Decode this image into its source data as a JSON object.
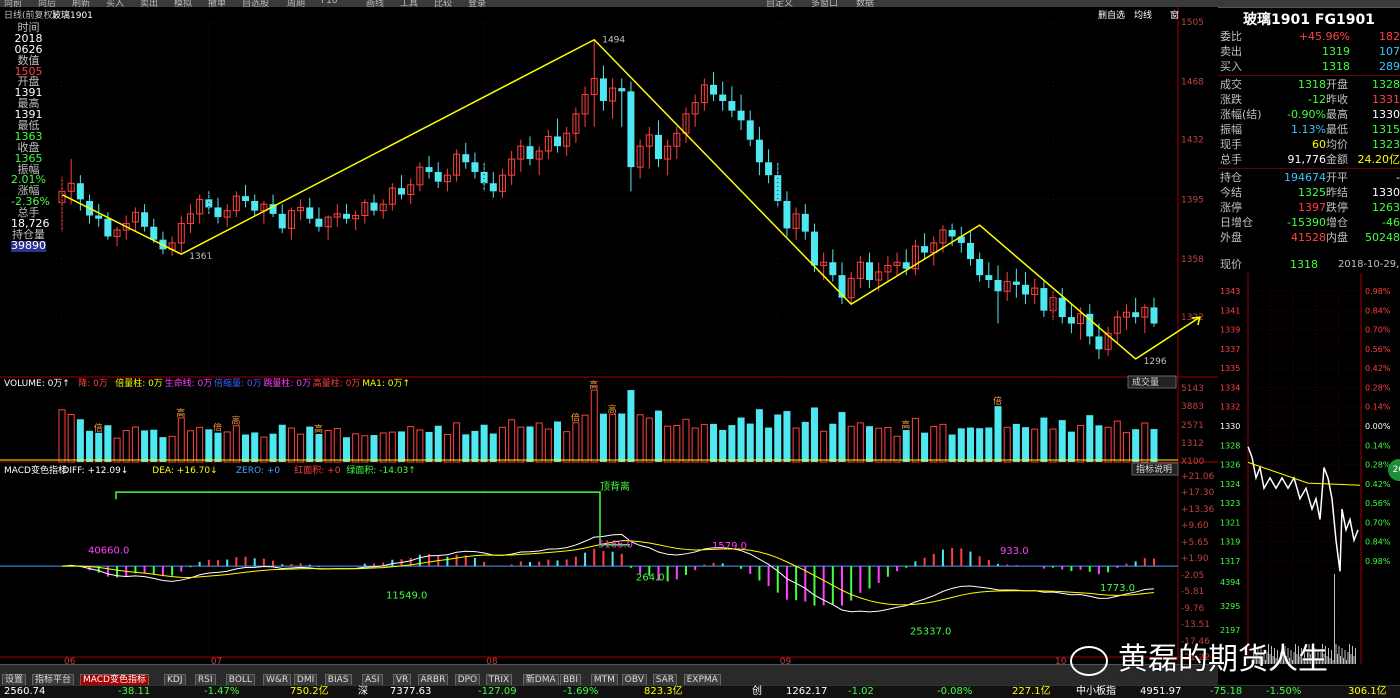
{
  "toolbar": {
    "buttons": [
      "向前",
      "向后",
      "刷新",
      "买入",
      "卖出",
      "模拟",
      "撤单",
      "自选股",
      "周期",
      "F10",
      "画线",
      "工具",
      "比较",
      "登录",
      "",
      "",
      "",
      "",
      "",
      "",
      "",
      "",
      "",
      "",
      "",
      "",
      "自定义",
      "多窗口",
      "数据"
    ]
  },
  "chart_header": {
    "title": "日线(前复权)",
    "symbol": "玻璃1901",
    "right_controls": [
      "删自选",
      "均线",
      "窗"
    ]
  },
  "sidebox": {
    "items": [
      {
        "label": "时间",
        "value": "2018"
      },
      {
        "label": "",
        "value": "0626"
      },
      {
        "label": "数值",
        "value": "1505"
      },
      {
        "label": "开盘",
        "value": "1391"
      },
      {
        "label": "最高",
        "value": "1391"
      },
      {
        "label": "最低",
        "value": "1363"
      },
      {
        "label": "收盘",
        "value": "1365"
      },
      {
        "label": "振幅",
        "value": "2.01%"
      },
      {
        "label": "涨幅",
        "value": "-2.36%"
      },
      {
        "label": "总手",
        "value": "18,726"
      },
      {
        "label": "持仓量",
        "value": "39890"
      }
    ]
  },
  "volume_header": {
    "items": [
      {
        "text": "VOLUME: 0万↑",
        "color": "#ffffff"
      },
      {
        "text": "降: 0万",
        "color": "#ff4040"
      },
      {
        "text": "倍量柱: 0万",
        "color": "#ffff00"
      },
      {
        "text": "生命线: 0万",
        "color": "#ff40ff"
      },
      {
        "text": "倍缩量: 0万",
        "color": "#4060ff"
      },
      {
        "text": "跳量柱: 0万",
        "color": "#ff40ff"
      },
      {
        "text": "高量柱: 0万",
        "color": "#ff4040"
      },
      {
        "text": "MA1: 0万↑",
        "color": "#ffff00"
      }
    ],
    "button": "成交量"
  },
  "macd_header": {
    "items": [
      {
        "text": "MACD变色指标",
        "color": "#ffffff"
      },
      {
        "text": "DIFF: +12.09↓",
        "color": "#ffffff"
      },
      {
        "text": "DEA: +16.70↓",
        "color": "#ffff00"
      },
      {
        "text": "ZERO: +0",
        "color": "#40a0ff"
      },
      {
        "text": "红面积: +0",
        "color": "#ff4040"
      },
      {
        "text": "绿面积: -14.03↑",
        "color": "#40ff40"
      }
    ],
    "button": "指标说明"
  },
  "macd_labels": [
    "40660.0",
    "11549.0",
    "5166.0",
    "264.0",
    "1579.0",
    "25337.0",
    "933.0",
    "1773.0"
  ],
  "macd_annotation": "顶背离",
  "volume_annotations": [
    "倍",
    "高",
    "倍",
    "高",
    "高",
    "倍",
    "高",
    "高",
    "高",
    "倍"
  ],
  "quote": {
    "title": "玻璃1901 FG1901",
    "rows1": [
      {
        "l": "委比",
        "v": "+45.96%",
        "vc": "#ff4040",
        "r": "182",
        "rc": "#ff4040"
      },
      {
        "l": "卖出",
        "v": "1319",
        "vc": "#40ff40",
        "r": "107",
        "rc": "#40c0ff"
      },
      {
        "l": "买入",
        "v": "1318",
        "vc": "#40ff40",
        "r": "289",
        "rc": "#40c0ff"
      }
    ],
    "rows2": [
      {
        "l": "成交",
        "v": "1318",
        "vc": "#40ff40",
        "l2": "开盘",
        "r": "1328",
        "rc": "#40ff40"
      },
      {
        "l": "涨跌",
        "v": "-12",
        "vc": "#40ff40",
        "l2": "昨收",
        "r": "1331",
        "rc": "#ff4040"
      },
      {
        "l": "涨幅(结)",
        "v": "-0.90%",
        "vc": "#40ff40",
        "l2": "最高",
        "r": "1330",
        "rc": "#ffffff"
      },
      {
        "l": "振幅",
        "v": "1.13%",
        "vc": "#40c0ff",
        "l2": "最低",
        "r": "1315",
        "rc": "#40ff40"
      },
      {
        "l": "现手",
        "v": "60",
        "vc": "#ffff00",
        "l2": "均价",
        "r": "1323",
        "rc": "#40ff40"
      },
      {
        "l": "总手",
        "v": "91,776",
        "vc": "#ffffff",
        "l2": "金额",
        "r": "24.20亿",
        "rc": "#ffff00"
      }
    ],
    "rows3": [
      {
        "l": "持仓",
        "v": "194674",
        "vc": "#40c0ff",
        "l2": "开平",
        "r": "-",
        "rc": "#ffffff"
      },
      {
        "l": "今结",
        "v": "1325",
        "vc": "#40ff40",
        "l2": "昨结",
        "r": "1330",
        "rc": "#ffffff"
      },
      {
        "l": "涨停",
        "v": "1397",
        "vc": "#ff4040",
        "l2": "跌停",
        "r": "1263",
        "rc": "#40ff40"
      },
      {
        "l": "日增仓",
        "v": "-15390",
        "vc": "#40ff40",
        "l2": "增仓",
        "r": "-46",
        "rc": "#40ff40"
      },
      {
        "l": "外盘",
        "v": "41528",
        "vc": "#ff4040",
        "l2": "内盘",
        "r": "50248",
        "rc": "#40ff40"
      }
    ]
  },
  "mini_chart": {
    "header_label": "现价",
    "header_price": "1318",
    "header_date": "2018-10-29,一",
    "price_ticks": [
      "1343",
      "1341",
      "1339",
      "1337",
      "1335",
      "1334",
      "1332",
      "1330",
      "1328",
      "1326",
      "1324",
      "1323",
      "1321",
      "1319",
      "1317"
    ],
    "pct_ticks": [
      "0.98%",
      "0.84%",
      "0.70%",
      "0.56%",
      "0.42%",
      "0.28%",
      "0.14%",
      "0.00%",
      "0.14%",
      "0.28%",
      "0.42%",
      "0.56%",
      "0.70%",
      "0.84%",
      "0.98%"
    ],
    "vol_ticks": [
      "4394",
      "3295",
      "2197"
    ],
    "badge": "2G"
  },
  "bottom_tabs": [
    "设置",
    "指标平台",
    "MACD变色指标",
    "KDJ",
    "RSI",
    "BOLL",
    "W&R",
    "DMI",
    "BIAS",
    "ASI",
    "VR",
    "ARBR",
    "DPO",
    "TRIX",
    "新DMA",
    "BBI",
    "MTM",
    "OBV",
    "SAR",
    "EXPMA"
  ],
  "ticker": [
    {
      "t": "2560.74",
      "c": "#ffffff"
    },
    {
      "t": "-38.11",
      "c": "#40ff40"
    },
    {
      "t": "-1.47%",
      "c": "#40ff40"
    },
    {
      "t": "750.2亿",
      "c": "#ffff00"
    },
    {
      "t": "深",
      "c": "#ffffff"
    },
    {
      "t": "7377.63",
      "c": "#ffffff"
    },
    {
      "t": "-127.09",
      "c": "#40ff40"
    },
    {
      "t": "-1.69%",
      "c": "#40ff40"
    },
    {
      "t": "823.3亿",
      "c": "#ffff00"
    },
    {
      "t": "创",
      "c": "#ffffff"
    },
    {
      "t": "1262.17",
      "c": "#ffffff"
    },
    {
      "t": "-1.02",
      "c": "#40ff40"
    },
    {
      "t": "-0.08%",
      "c": "#40ff40"
    },
    {
      "t": "227.1亿",
      "c": "#ffff00"
    },
    {
      "t": "中小板指",
      "c": "#ffffff"
    },
    {
      "t": "4951.97",
      "c": "#ffffff"
    },
    {
      "t": "-75.18",
      "c": "#40ff40"
    },
    {
      "t": "-1.50%",
      "c": "#40ff40"
    },
    {
      "t": "306.1亿",
      "c": "#ffff00"
    }
  ],
  "watermark": "黄磊的期货人生",
  "chart_data": [
    {
      "type": "candlestick",
      "yticks": [
        1505,
        1468,
        1432,
        1395,
        1358,
        1322
      ],
      "ylim": [
        1296,
        1505
      ],
      "x_date_labels": [
        "06",
        "07",
        "08",
        "09",
        "10"
      ],
      "x_date_index": [
        0,
        16,
        46,
        78,
        108
      ],
      "zigzag": [
        {
          "i": 0,
          "price": 1398,
          "label": ""
        },
        {
          "i": 13,
          "price": 1361,
          "label": "1361"
        },
        {
          "i": 58,
          "price": 1494,
          "label": "1494"
        },
        {
          "i": 86,
          "price": 1330,
          "label": ""
        },
        {
          "i": 100,
          "price": 1379,
          "label": ""
        },
        {
          "i": 117,
          "price": 1296,
          "label": "1296"
        },
        {
          "i": 124,
          "price": 1322,
          "label": ""
        }
      ],
      "ohlc": [
        [
          1393,
          1409,
          1375,
          1400
        ],
        [
          1400,
          1420,
          1392,
          1405
        ],
        [
          1405,
          1410,
          1388,
          1395
        ],
        [
          1394,
          1398,
          1380,
          1385
        ],
        [
          1385,
          1392,
          1378,
          1383
        ],
        [
          1383,
          1387,
          1370,
          1372
        ],
        [
          1372,
          1378,
          1366,
          1376
        ],
        [
          1376,
          1385,
          1370,
          1380
        ],
        [
          1381,
          1390,
          1375,
          1387
        ],
        [
          1387,
          1392,
          1375,
          1378
        ],
        [
          1378,
          1383,
          1368,
          1370
        ],
        [
          1370,
          1375,
          1361,
          1364
        ],
        [
          1364,
          1372,
          1360,
          1368
        ],
        [
          1368,
          1385,
          1362,
          1380
        ],
        [
          1380,
          1392,
          1374,
          1386
        ],
        [
          1386,
          1398,
          1380,
          1395
        ],
        [
          1395,
          1400,
          1386,
          1390
        ],
        [
          1390,
          1396,
          1380,
          1384
        ],
        [
          1384,
          1392,
          1378,
          1388
        ],
        [
          1388,
          1400,
          1384,
          1397
        ],
        [
          1397,
          1404,
          1390,
          1394
        ],
        [
          1394,
          1398,
          1385,
          1388
        ],
        [
          1388,
          1394,
          1380,
          1392
        ],
        [
          1392,
          1398,
          1384,
          1386
        ],
        [
          1386,
          1392,
          1374,
          1377
        ],
        [
          1377,
          1390,
          1370,
          1388
        ],
        [
          1388,
          1395,
          1382,
          1390
        ],
        [
          1390,
          1396,
          1380,
          1383
        ],
        [
          1383,
          1390,
          1375,
          1378
        ],
        [
          1378,
          1385,
          1370,
          1384
        ],
        [
          1384,
          1392,
          1378,
          1386
        ],
        [
          1386,
          1392,
          1380,
          1383
        ],
        [
          1383,
          1388,
          1376,
          1385
        ],
        [
          1385,
          1395,
          1380,
          1393
        ],
        [
          1393,
          1398,
          1385,
          1388
        ],
        [
          1388,
          1395,
          1383,
          1392
        ],
        [
          1392,
          1405,
          1388,
          1402
        ],
        [
          1402,
          1410,
          1395,
          1398
        ],
        [
          1398,
          1408,
          1392,
          1404
        ],
        [
          1404,
          1418,
          1400,
          1415
        ],
        [
          1415,
          1422,
          1408,
          1412
        ],
        [
          1412,
          1418,
          1402,
          1406
        ],
        [
          1406,
          1414,
          1400,
          1410
        ],
        [
          1410,
          1426,
          1406,
          1423
        ],
        [
          1423,
          1430,
          1414,
          1418
        ],
        [
          1418,
          1424,
          1408,
          1412
        ],
        [
          1412,
          1418,
          1400,
          1405
        ],
        [
          1405,
          1412,
          1396,
          1400
        ],
        [
          1400,
          1414,
          1396,
          1410
        ],
        [
          1410,
          1425,
          1404,
          1420
        ],
        [
          1420,
          1432,
          1412,
          1428
        ],
        [
          1428,
          1434,
          1416,
          1420
        ],
        [
          1420,
          1428,
          1410,
          1425
        ],
        [
          1425,
          1438,
          1420,
          1434
        ],
        [
          1434,
          1445,
          1424,
          1428
        ],
        [
          1428,
          1440,
          1422,
          1436
        ],
        [
          1436,
          1452,
          1430,
          1448
        ],
        [
          1448,
          1465,
          1440,
          1460
        ],
        [
          1460,
          1494,
          1440,
          1470
        ],
        [
          1470,
          1478,
          1450,
          1456
        ],
        [
          1456,
          1470,
          1445,
          1464
        ],
        [
          1464,
          1470,
          1440,
          1462
        ],
        [
          1462,
          1468,
          1400,
          1415
        ],
        [
          1415,
          1432,
          1408,
          1428
        ],
        [
          1428,
          1440,
          1414,
          1435
        ],
        [
          1435,
          1444,
          1415,
          1420
        ],
        [
          1420,
          1432,
          1410,
          1428
        ],
        [
          1428,
          1440,
          1420,
          1436
        ],
        [
          1436,
          1452,
          1430,
          1448
        ],
        [
          1448,
          1460,
          1440,
          1455
        ],
        [
          1455,
          1470,
          1450,
          1466
        ],
        [
          1466,
          1474,
          1456,
          1460
        ],
        [
          1460,
          1468,
          1450,
          1456
        ],
        [
          1456,
          1465,
          1446,
          1450
        ],
        [
          1450,
          1460,
          1438,
          1444
        ],
        [
          1444,
          1450,
          1428,
          1432
        ],
        [
          1432,
          1440,
          1410,
          1418
        ],
        [
          1418,
          1426,
          1405,
          1410
        ],
        [
          1410,
          1418,
          1390,
          1394
        ],
        [
          1394,
          1400,
          1372,
          1377
        ],
        [
          1377,
          1390,
          1370,
          1386
        ],
        [
          1386,
          1392,
          1370,
          1375
        ],
        [
          1375,
          1380,
          1350,
          1354
        ],
        [
          1354,
          1362,
          1345,
          1356
        ],
        [
          1356,
          1364,
          1344,
          1348
        ],
        [
          1348,
          1356,
          1330,
          1334
        ],
        [
          1334,
          1350,
          1330,
          1346
        ],
        [
          1346,
          1360,
          1340,
          1356
        ],
        [
          1356,
          1362,
          1340,
          1345
        ],
        [
          1345,
          1356,
          1338,
          1350
        ],
        [
          1350,
          1360,
          1344,
          1354
        ],
        [
          1354,
          1362,
          1348,
          1356
        ],
        [
          1356,
          1364,
          1348,
          1352
        ],
        [
          1352,
          1370,
          1348,
          1366
        ],
        [
          1366,
          1374,
          1358,
          1362
        ],
        [
          1362,
          1372,
          1354,
          1368
        ],
        [
          1368,
          1379,
          1362,
          1376
        ],
        [
          1376,
          1380,
          1366,
          1372
        ],
        [
          1372,
          1378,
          1362,
          1368
        ],
        [
          1368,
          1375,
          1354,
          1358
        ],
        [
          1358,
          1362,
          1344,
          1348
        ],
        [
          1348,
          1356,
          1340,
          1345
        ],
        [
          1345,
          1354,
          1318,
          1338
        ],
        [
          1338,
          1350,
          1332,
          1344
        ],
        [
          1344,
          1352,
          1334,
          1342
        ],
        [
          1342,
          1350,
          1330,
          1336
        ],
        [
          1336,
          1346,
          1330,
          1340
        ],
        [
          1340,
          1344,
          1322,
          1326
        ],
        [
          1326,
          1338,
          1320,
          1334
        ],
        [
          1334,
          1340,
          1318,
          1322
        ],
        [
          1322,
          1330,
          1312,
          1318
        ],
        [
          1318,
          1328,
          1308,
          1324
        ],
        [
          1324,
          1330,
          1305,
          1310
        ],
        [
          1310,
          1318,
          1296,
          1302
        ],
        [
          1302,
          1316,
          1298,
          1312
        ],
        [
          1312,
          1326,
          1306,
          1322
        ],
        [
          1322,
          1330,
          1314,
          1325
        ],
        [
          1325,
          1334,
          1318,
          1322
        ],
        [
          1322,
          1330,
          1312,
          1328
        ],
        [
          1328,
          1334,
          1316,
          1318
        ]
      ]
    },
    {
      "type": "bar",
      "name": "volume",
      "yticks": [
        5143,
        3883,
        2571,
        1312
      ],
      "ylim": [
        0,
        5143
      ]
    },
    {
      "type": "macd",
      "yticks": [
        "21.06",
        "17.30",
        "13.36",
        "9.60",
        "5.65",
        "1.90",
        "-2.05",
        "-5.81",
        "-9.76",
        "-13.51",
        "-17.46",
        "-21.22"
      ],
      "ylim": [
        -21.22,
        21.06
      ]
    }
  ]
}
